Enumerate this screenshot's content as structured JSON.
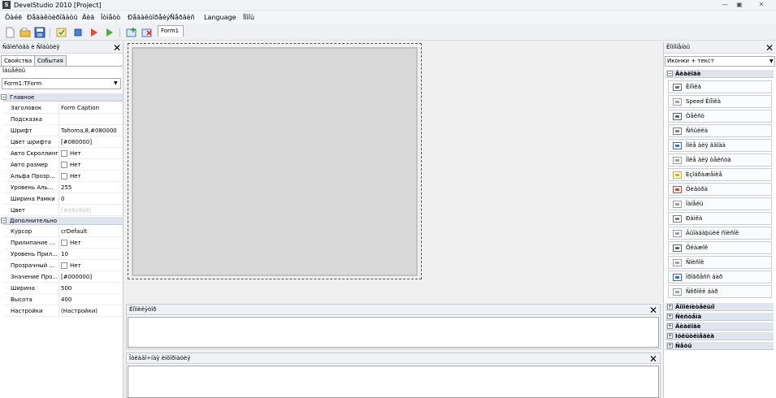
{
  "window": {
    "logo": "S",
    "title": "DevelStudio 2010 [Project]",
    "controls": [
      "—",
      "▣",
      "✕"
    ]
  },
  "menu": [
    "Ôàéë",
    "Ðåäàêòèðîâàòü",
    "Âèä",
    "Îòìåòò",
    "Ðåäàêòîðåéý",
    "Ñåðâèñ",
    "Language",
    "Ïîìîù"
  ],
  "toolbar": {
    "tab_label": "Form1",
    "icons": [
      "new-file-icon",
      "open-folder-icon",
      "save-icon",
      "compile-icon",
      "stop-icon",
      "run-icon",
      "debug-run-icon",
      "add-form-icon",
      "remove-form-icon"
    ]
  },
  "inspector": {
    "title": "Ñâîéñòâà è Ñîáûòèÿ",
    "tabs": [
      "Свойства",
      "События"
    ],
    "objects_label": "Îáúåêòû",
    "object_select": "Form1:TForm",
    "group_main": "Главное",
    "group_extra": "Дополнительно",
    "main_props": [
      {
        "name": "Заголовок",
        "value": "Form Caption",
        "check": false
      },
      {
        "name": "Подсказка",
        "value": "",
        "check": false
      },
      {
        "name": "Шрифт",
        "value": "Tahoma,8,#080000",
        "check": false
      },
      {
        "name": "Цвет шрифта",
        "value": "[#080000]",
        "check": false
      },
      {
        "name": "Авто Скроллинг",
        "value": "Нет",
        "check": true
      },
      {
        "name": "Авто размер",
        "value": "Нет",
        "check": true
      },
      {
        "name": "Альфа Прозр...",
        "value": "Нет",
        "check": true
      },
      {
        "name": "Уровень Аль...",
        "value": "255",
        "check": false
      },
      {
        "name": "Ширина Рамки",
        "value": "0",
        "check": false
      },
      {
        "name": "Цвет",
        "value": "[#e8e8e8]",
        "check": false
      }
    ],
    "extra_props": [
      {
        "name": "Курсор",
        "value": "crDefault",
        "check": false
      },
      {
        "name": "Прилипание ...",
        "value": "Нет",
        "check": true
      },
      {
        "name": "Уровень Прил...",
        "value": "10",
        "check": false
      },
      {
        "name": "Прозрачный ...",
        "value": "Нет",
        "check": true
      },
      {
        "name": "Значение Про...",
        "value": "[#000000]",
        "check": false
      },
      {
        "name": "Ширина",
        "value": "500",
        "check": false
      },
      {
        "name": "Высота",
        "value": "400",
        "check": false
      },
      {
        "name": "Настройки",
        "value": "(Настройки)",
        "check": false
      }
    ]
  },
  "panels": {
    "messages_title": "Êîìïèëÿòîð",
    "debug_title": "Îòëàäî÷íàÿ èíôîðìàöèÿ"
  },
  "components": {
    "title": "Êîìïîíåíòû",
    "view_select": "Иконки + текст",
    "open_group": "Äèàëîãè",
    "items": [
      {
        "label": "Êíîïêà",
        "icon": "button-icon",
        "color": "#6a7080"
      },
      {
        "label": "Speed Êíîïêà",
        "icon": "speed-button-icon",
        "color": "#9aa0aa"
      },
      {
        "label": "Òåêñò",
        "icon": "label-icon",
        "color": "#5c6470"
      },
      {
        "label": "Ññûëêà",
        "icon": "link-icon",
        "color": "#7b7f88"
      },
      {
        "label": "Ïîëå äëÿ ââîäà",
        "icon": "edit-icon",
        "color": "#3b6fd1"
      },
      {
        "label": "Ïîëå äëÿ òåêñòà",
        "icon": "memo-icon",
        "color": "#9aa0aa"
      },
      {
        "label": "Èçîáðàæåíèå",
        "icon": "image-icon",
        "color": "#d8b020"
      },
      {
        "label": "Ôèãóðà",
        "icon": "shape-icon",
        "color": "#c84a2a"
      },
      {
        "label": "Ïàíåëü",
        "icon": "panel-icon",
        "color": "#9aa0aa"
      },
      {
        "label": "Ðàìêà",
        "icon": "frame-icon",
        "color": "#7b7f88"
      },
      {
        "label": "Âûïàäàþùèé ñïèñîê",
        "icon": "combobox-icon",
        "color": "#9aa0aa"
      },
      {
        "label": "Ôëàæîê",
        "icon": "checkbox-icon",
        "color": "#5c6470"
      },
      {
        "label": "Ñïèñîê",
        "icon": "listbox-icon",
        "color": "#9aa0aa"
      },
      {
        "label": "Ïðîãðåññ áàð",
        "icon": "progressbar-icon",
        "color": "#2f6fd6"
      },
      {
        "label": "Ñêðîëë áàð",
        "icon": "scrollbar-icon",
        "color": "#9aa0aa"
      }
    ],
    "groups": [
      "Äîïîëíèòåëüíî",
      "Ñèñòåìà",
      "Äèàëîãè",
      "Ìóëüòèìåäèà",
      "Ñåòü"
    ]
  }
}
